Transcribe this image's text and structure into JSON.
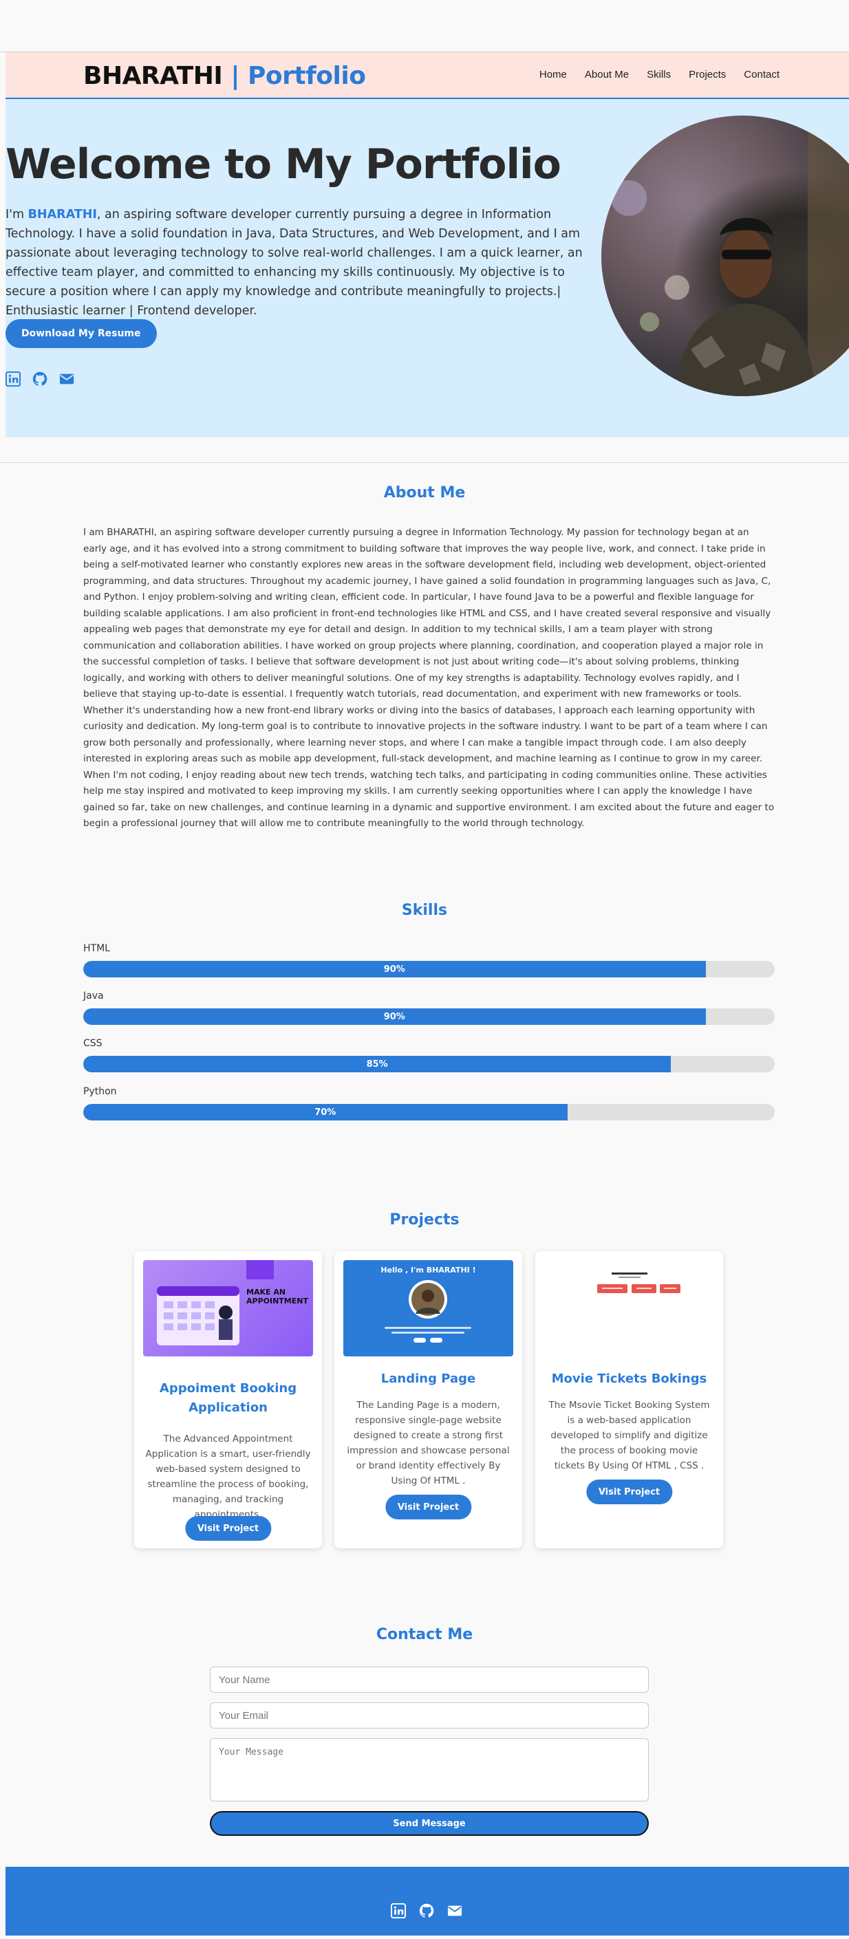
{
  "header": {
    "brand_name": "BHARATHI",
    "brand_sep": "|",
    "brand_suffix": "Portfolio",
    "nav": [
      "Home",
      "About Me",
      "Skills",
      "Projects",
      "Contact"
    ]
  },
  "hero": {
    "title": "Welcome to My Portfolio",
    "intro_prefix": "I'm ",
    "intro_name": "BHARATHI",
    "intro_rest": ", an aspiring software developer currently pursuing a degree in Information Technology. I have a solid foundation in Java, Data Structures, and Web Development, and I am passionate about leveraging technology to solve real-world challenges. I am a quick learner, an effective team player, and committed to enhancing my skills continuously. My objective is to secure a position where I can apply my knowledge and contribute meaningfully to projects.| Enthusiastic learner | Frontend developer.",
    "resume_button": "Download My Resume",
    "social_icons": [
      "linkedin-icon",
      "github-icon",
      "envelope-icon"
    ]
  },
  "about": {
    "title": "About Me",
    "text": "I am BHARATHI, an aspiring software developer currently pursuing a degree in Information Technology. My passion for technology began at an early age, and it has evolved into a strong commitment to building software that improves the way people live, work, and connect. I take pride in being a self-motivated learner who constantly explores new areas in the software development field, including web development, object-oriented programming, and data structures. Throughout my academic journey, I have gained a solid foundation in programming languages such as Java, C, and Python. I enjoy problem-solving and writing clean, efficient code. In particular, I have found Java to be a powerful and flexible language for building scalable applications. I am also proficient in front-end technologies like HTML and CSS, and I have created several responsive and visually appealing web pages that demonstrate my eye for detail and design. In addition to my technical skills, I am a team player with strong communication and collaboration abilities. I have worked on group projects where planning, coordination, and cooperation played a major role in the successful completion of tasks. I believe that software development is not just about writing code—it's about solving problems, thinking logically, and working with others to deliver meaningful solutions. One of my key strengths is adaptability. Technology evolves rapidly, and I believe that staying up-to-date is essential. I frequently watch tutorials, read documentation, and experiment with new frameworks or tools. Whether it's understanding how a new front-end library works or diving into the basics of databases, I approach each learning opportunity with curiosity and dedication. My long-term goal is to contribute to innovative projects in the software industry. I want to be part of a team where I can grow both personally and professionally, where learning never stops, and where I can make a tangible impact through code. I am also deeply interested in exploring areas such as mobile app development, full-stack development, and machine learning as I continue to grow in my career. When I'm not coding, I enjoy reading about new tech trends, watching tech talks, and participating in coding communities online. These activities help me stay inspired and motivated to keep improving my skills. I am currently seeking opportunities where I can apply the knowledge I have gained so far, take on new challenges, and continue learning in a dynamic and supportive environment. I am excited about the future and eager to begin a professional journey that will allow me to contribute meaningfully to the world through technology."
  },
  "skills": {
    "title": "Skills",
    "items": [
      {
        "name": "HTML",
        "percent": 90,
        "label": "90%"
      },
      {
        "name": "Java",
        "percent": 90,
        "label": "90%"
      },
      {
        "name": "CSS",
        "percent": 85,
        "label": "85%"
      },
      {
        "name": "Python",
        "percent": 70,
        "label": "70%"
      }
    ]
  },
  "projects": {
    "title": "Projects",
    "items": [
      {
        "title": "Appoiment Booking Application",
        "description": "The Advanced Appointment Application is a smart, user-friendly web-based system designed to streamline the process of booking, managing, and tracking appointments.",
        "button": "Visit Project",
        "thumb_text": "MAKE AN APPOINTMENT"
      },
      {
        "title": "Landing Page",
        "description": "The Landing Page is a modern, responsive single-page website designed to create a strong first impression and showcase personal or brand identity effectively By Using Of HTML .",
        "button": "Visit Project",
        "thumb_text": "Hello , I'm BHARATHI !"
      },
      {
        "title": "Movie Tickets Bokings",
        "description": "The Msovie Ticket Booking System is a web-based application developed to simplify and digitize the process of booking movie tickets By Using Of HTML , CSS .",
        "button": "Visit Project"
      }
    ]
  },
  "contact": {
    "title": "Contact Me",
    "name_placeholder": "Your Name",
    "email_placeholder": "Your Email",
    "message_placeholder": "Your Message",
    "send_button": "Send Message"
  },
  "footer": {
    "social_icons": [
      "linkedin-icon",
      "github-icon",
      "envelope-icon"
    ]
  },
  "colors": {
    "accent": "#2b7bd8",
    "header_bg": "#fde4de",
    "hero_bg": "#d6edfd",
    "page_bg": "#f9f9f9"
  }
}
